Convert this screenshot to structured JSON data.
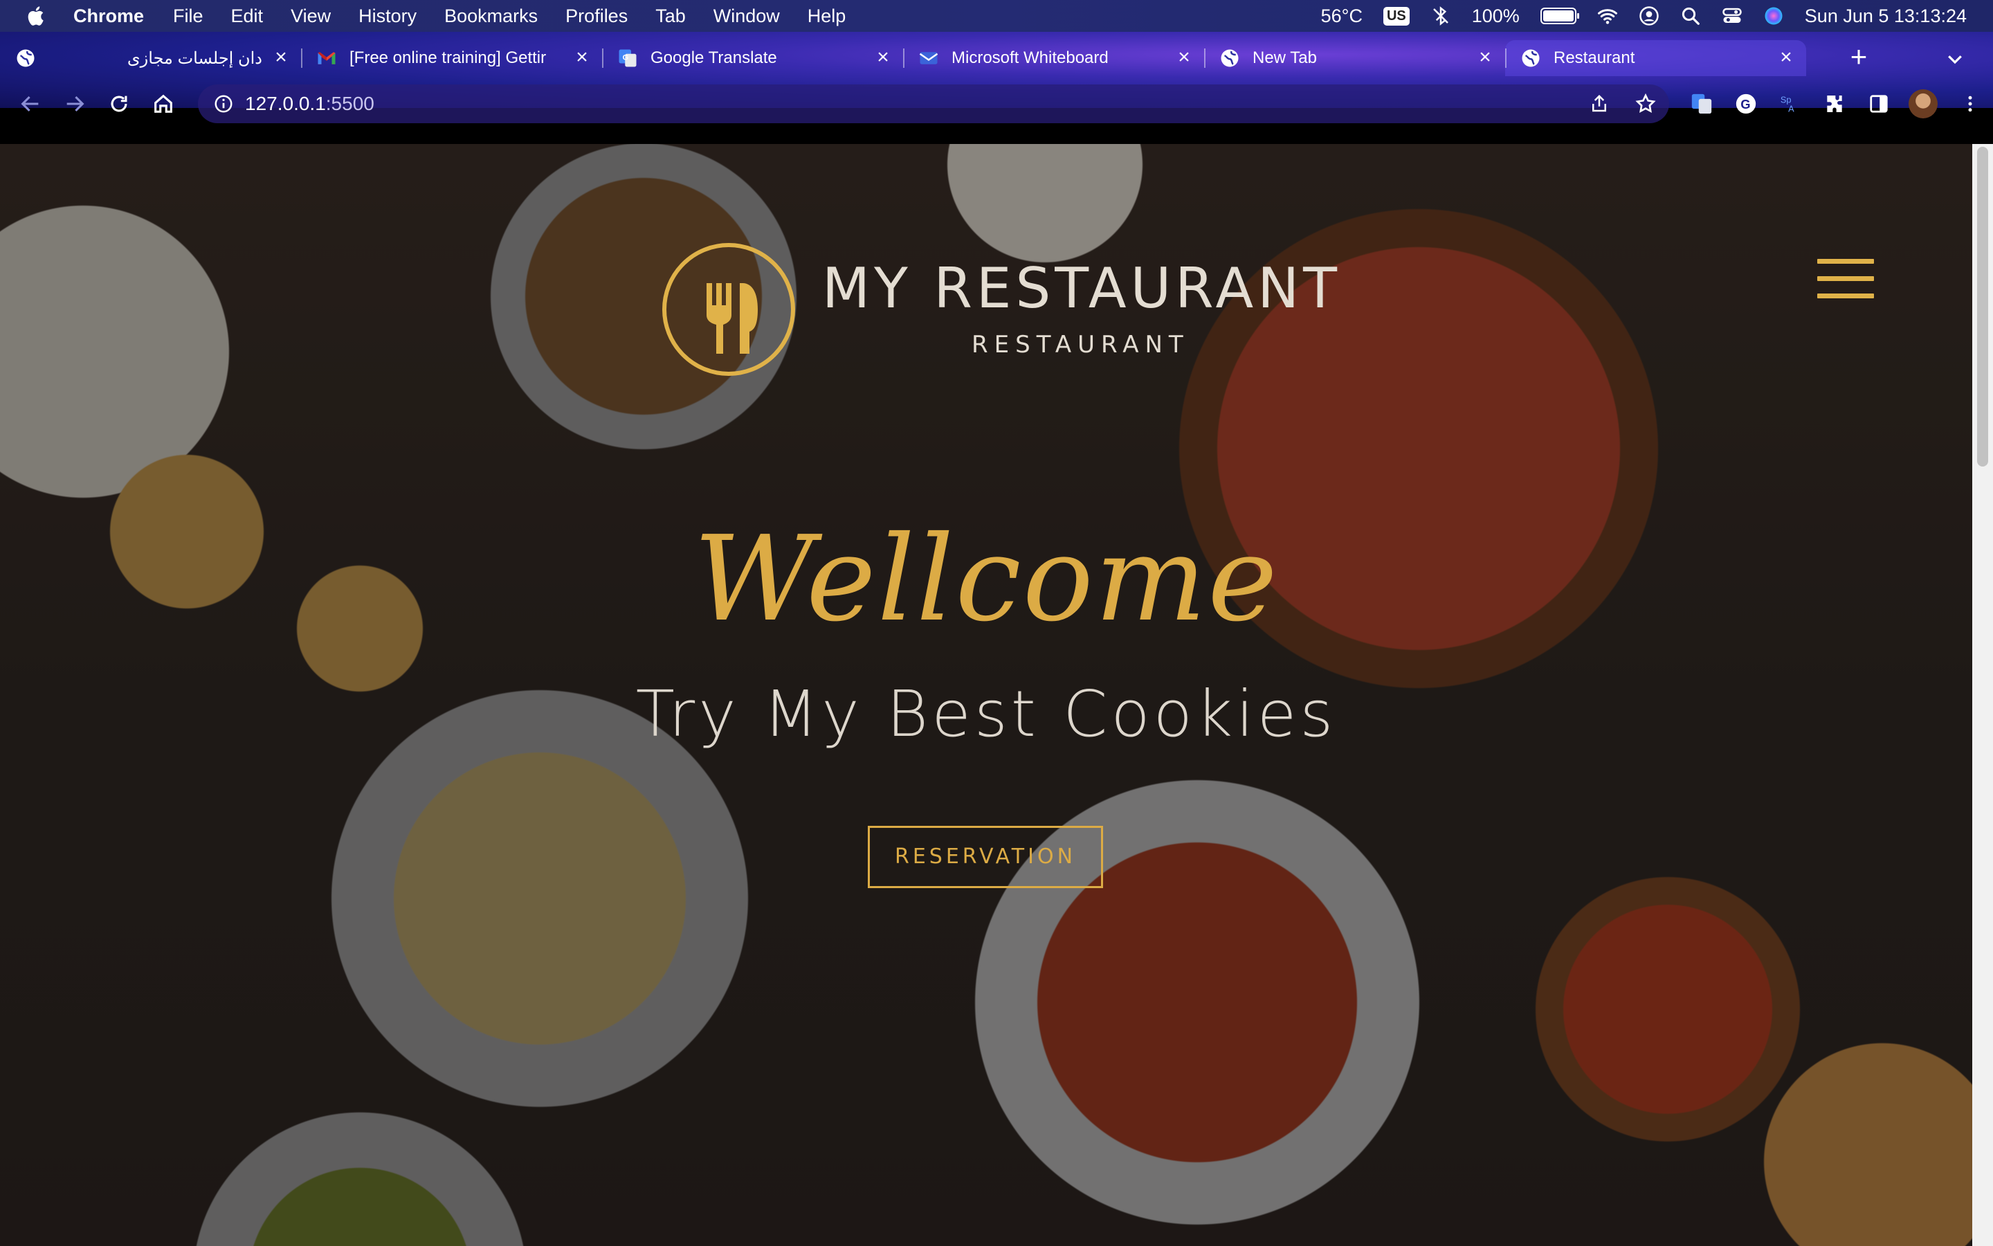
{
  "menubar": {
    "app_name": "Chrome",
    "menus": [
      "File",
      "Edit",
      "View",
      "History",
      "Bookmarks",
      "Profiles",
      "Tab",
      "Window",
      "Help"
    ],
    "temperature": "56°C",
    "input_source": "US",
    "battery": "100%",
    "battery_level": 1.0,
    "datetime": "Sun Jun 5  13:13:24"
  },
  "browser": {
    "tabs": [
      {
        "title": "دان إجلسات مجازى",
        "favicon": "globe-icon"
      },
      {
        "title": "[Free online training] Gettir",
        "favicon": "gmail-icon"
      },
      {
        "title": "Google Translate",
        "favicon": "google-translate-icon"
      },
      {
        "title": "Microsoft Whiteboard",
        "favicon": "mail-icon"
      },
      {
        "title": "New Tab",
        "favicon": "globe-icon"
      },
      {
        "title": "Restaurant",
        "favicon": "globe-icon",
        "active": true
      }
    ],
    "url_host": "127.0.0.1",
    "url_port": ":5500"
  },
  "site": {
    "brand_title": "MY RESTAURANT",
    "brand_subtitle": "RESTAURANT",
    "welcome": "Wellcome",
    "tagline": "Try My Best Cookies",
    "cta_label": "RESERVATION",
    "accent_color": "#dcab45"
  }
}
